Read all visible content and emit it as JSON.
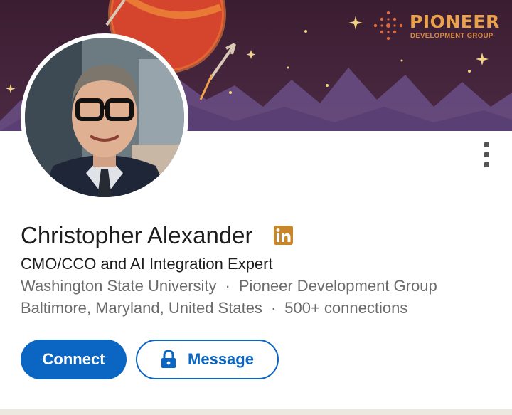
{
  "banner": {
    "brand_name": "PIONEER",
    "brand_subtitle": "DEVELOPMENT GROUP"
  },
  "profile": {
    "name": "Christopher Alexander",
    "headline": "CMO/CCO and AI Integration Expert",
    "education": "Washington State University",
    "company": "Pioneer Development Group",
    "location": "Baltimore, Maryland, United States",
    "connections": "500+ connections",
    "separator": "·"
  },
  "actions": {
    "connect_label": "Connect",
    "message_label": "Message"
  },
  "icons": {
    "badge": "linkedin-badge-icon",
    "more": "more-options-icon",
    "lock": "lock-icon"
  },
  "colors": {
    "primary": "#0a66c2",
    "banner_bg": "#3a2033",
    "brand_orange": "#e9a14a",
    "linkedin_badge": "#c8862a",
    "text": "#1d1d1d",
    "muted": "#6b6b6b"
  }
}
